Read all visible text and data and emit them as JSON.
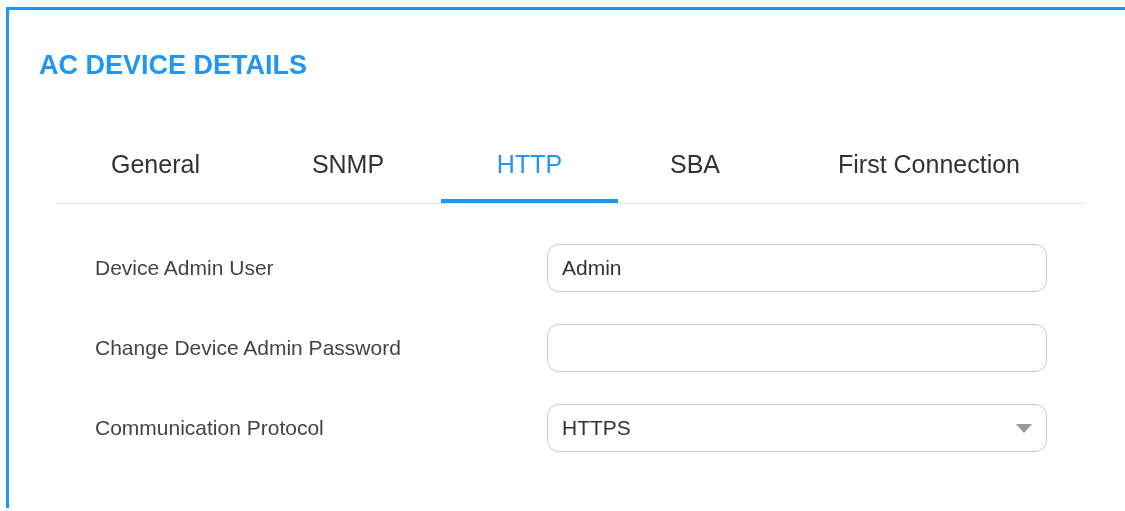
{
  "title": "AC DEVICE DETAILS",
  "tabs": [
    {
      "label": "General",
      "selected": false
    },
    {
      "label": "SNMP",
      "selected": false
    },
    {
      "label": "HTTP",
      "selected": true
    },
    {
      "label": "SBA",
      "selected": false
    },
    {
      "label": "First Connection",
      "selected": false
    }
  ],
  "fields": [
    {
      "kind": "text",
      "label": "Device Admin User",
      "value": "Admin"
    },
    {
      "kind": "password",
      "label": "Change Device Admin Password"
    },
    {
      "kind": "select",
      "label": "Communication Protocol",
      "value": "HTTPS"
    }
  ]
}
